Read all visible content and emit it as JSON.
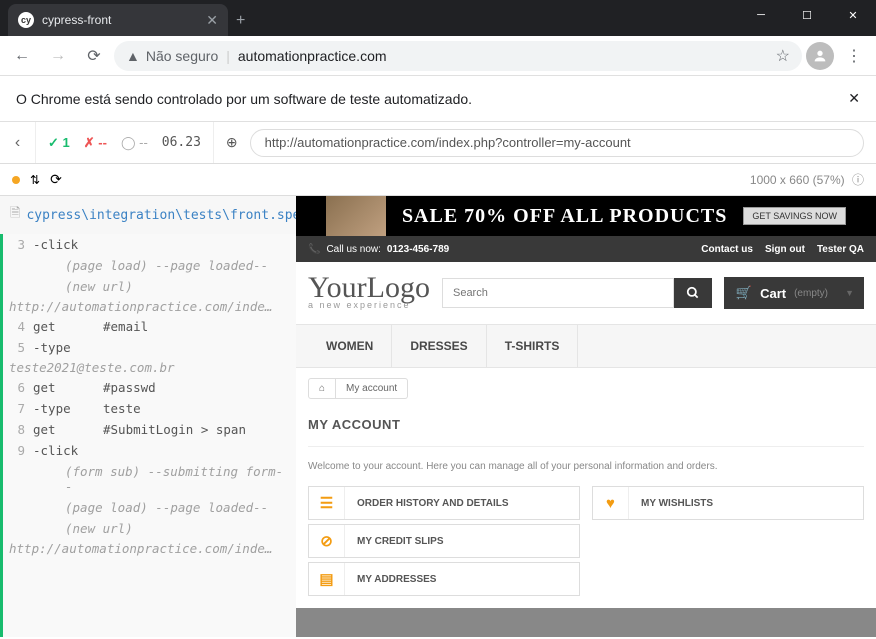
{
  "browser": {
    "tab_title": "cypress-front",
    "favicon_text": "cy",
    "security_label": "Não seguro",
    "url_display": "automationpractice.com",
    "automation_notice": "O Chrome está sendo controlado por um software de teste automatizado."
  },
  "cypress": {
    "pass_count": "1",
    "fail_count": "--",
    "pending": "--",
    "time": "06.23",
    "app_url": "http://automationpractice.com/index.php?controller=my-account",
    "viewport": "1000 x 660",
    "scale": "(57%)",
    "spec_file": "cypress\\integration\\tests\\front.spec.js",
    "log": [
      {
        "num": "3",
        "cmd": "-click",
        "msg": ""
      },
      {
        "sub": "(page load)  --page loaded--"
      },
      {
        "sub": "(new url)"
      },
      {
        "url": "http://automationpractice.com/inde…"
      },
      {
        "num": "4",
        "cmd": "get",
        "msg": "#email"
      },
      {
        "num": "5",
        "cmd": "-type",
        "msg": ""
      },
      {
        "url": "teste2021@teste.com.br"
      },
      {
        "num": "6",
        "cmd": "get",
        "msg": "#passwd"
      },
      {
        "num": "7",
        "cmd": "-type",
        "msg": "teste"
      },
      {
        "num": "8",
        "cmd": "get",
        "msg": "#SubmitLogin > span"
      },
      {
        "num": "9",
        "cmd": "-click",
        "msg": ""
      },
      {
        "sub": "(form sub)  --submitting form--"
      },
      {
        "sub": "(page load)  --page loaded--"
      },
      {
        "sub": "(new url)"
      },
      {
        "url": "http://automationpractice.com/inde…"
      }
    ]
  },
  "site": {
    "promo_text": "SALE 70% OFF ALL PRODUCTS",
    "promo_btn": "GET SAVINGS NOW",
    "call_label": "Call us now:",
    "phone": "0123-456-789",
    "topbar_links": [
      "Contact us",
      "Sign out",
      "Tester QA"
    ],
    "logo_main": "YourLogo",
    "logo_sub": "a new experience",
    "search_placeholder": "Search",
    "cart_label": "Cart",
    "cart_empty": "(empty)",
    "nav": [
      "WOMEN",
      "DRESSES",
      "T-SHIRTS"
    ],
    "breadcrumb_home": "⌂",
    "breadcrumb_current": "My account",
    "page_title": "MY ACCOUNT",
    "welcome": "Welcome to your account. Here you can manage all of your personal information and orders.",
    "account_left": [
      {
        "icon": "☰",
        "label": "ORDER HISTORY AND DETAILS"
      },
      {
        "icon": "⊘",
        "label": "MY CREDIT SLIPS"
      },
      {
        "icon": "▤",
        "label": "MY ADDRESSES"
      }
    ],
    "account_right": [
      {
        "icon": "♥",
        "label": "MY WISHLISTS"
      }
    ]
  }
}
